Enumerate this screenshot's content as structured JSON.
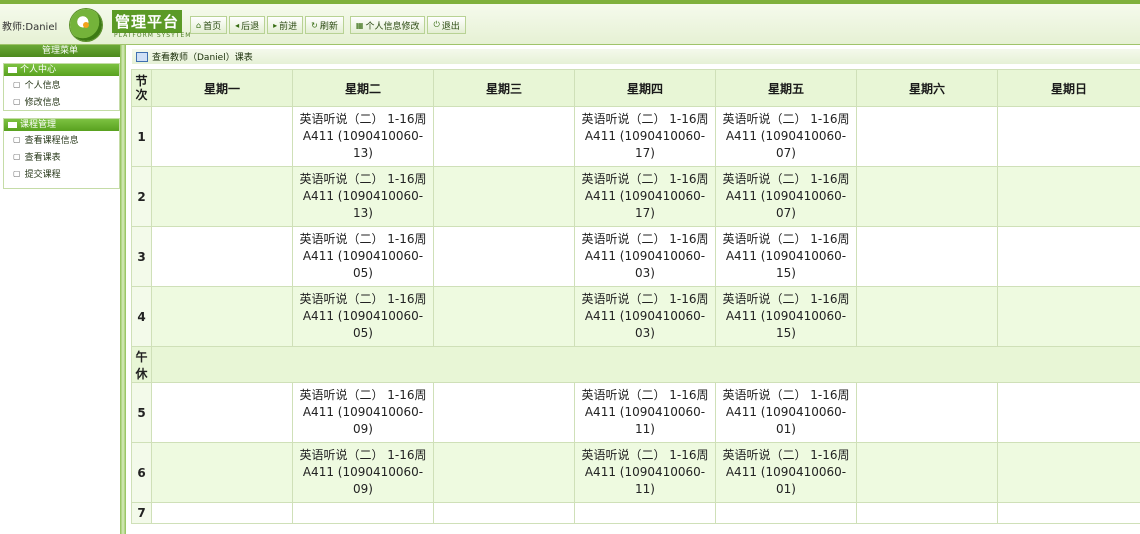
{
  "header": {
    "user_label": "教师:Daniel",
    "logo_title": "管理平台",
    "logo_subtitle": "PLATFORM SYSYTEM",
    "toolbar": [
      {
        "name": "home-button",
        "icon": "home-icon",
        "glyph": "⌂",
        "label": "首页"
      },
      {
        "name": "back-button",
        "icon": "back-icon",
        "glyph": "◂",
        "label": "后退"
      },
      {
        "name": "forward-button",
        "icon": "forward-icon",
        "glyph": "▸",
        "label": "前进"
      },
      {
        "name": "refresh-button",
        "icon": "refresh-icon",
        "glyph": "↻",
        "label": "刷新"
      },
      {
        "name": "edit-profile-button",
        "icon": "profile-icon",
        "glyph": "▦",
        "label": "个人信息修改"
      },
      {
        "name": "logout-button",
        "icon": "power-icon",
        "glyph": "⏻",
        "label": "退出"
      }
    ]
  },
  "sidebar": {
    "title": "管理菜单",
    "groups": [
      {
        "title": "个人中心",
        "items": [
          "个人信息",
          "修改信息"
        ]
      },
      {
        "title": "课程管理",
        "items": [
          "查看课程信息",
          "查看课表",
          "提交课程"
        ]
      }
    ]
  },
  "main": {
    "title": "查看教师（Daniel）课表",
    "table": {
      "period_header": "节次",
      "days": [
        "星期一",
        "星期二",
        "星期三",
        "星期四",
        "星期五",
        "星期六",
        "星期日"
      ],
      "noon_label": "午休",
      "rows": [
        {
          "period": "1",
          "cells": [
            "",
            "英语听说（二） 1-16周 A411 (1090410060-13)",
            "",
            "英语听说（二） 1-16周 A411 (1090410060-17)",
            "英语听说（二） 1-16周 A411 (1090410060-07)",
            "",
            ""
          ]
        },
        {
          "period": "2",
          "cells": [
            "",
            "英语听说（二） 1-16周 A411 (1090410060-13)",
            "",
            "英语听说（二） 1-16周 A411 (1090410060-17)",
            "英语听说（二） 1-16周 A411 (1090410060-07)",
            "",
            ""
          ]
        },
        {
          "period": "3",
          "cells": [
            "",
            "英语听说（二） 1-16周 A411 (1090410060-05)",
            "",
            "英语听说（二） 1-16周 A411 (1090410060-03)",
            "英语听说（二） 1-16周 A411 (1090410060-15)",
            "",
            ""
          ]
        },
        {
          "period": "4",
          "cells": [
            "",
            "英语听说（二） 1-16周 A411 (1090410060-05)",
            "",
            "英语听说（二） 1-16周 A411 (1090410060-03)",
            "英语听说（二） 1-16周 A411 (1090410060-15)",
            "",
            ""
          ]
        },
        {
          "period": "5",
          "cells": [
            "",
            "英语听说（二） 1-16周 A411 (1090410060-09)",
            "",
            "英语听说（二） 1-16周 A411 (1090410060-11)",
            "英语听说（二） 1-16周 A411 (1090410060-01)",
            "",
            ""
          ]
        },
        {
          "period": "6",
          "cells": [
            "",
            "英语听说（二） 1-16周 A411 (1090410060-09)",
            "",
            "英语听说（二） 1-16周 A411 (1090410060-11)",
            "英语听说（二） 1-16周 A411 (1090410060-01)",
            "",
            ""
          ]
        },
        {
          "period": "7",
          "cells": [
            "",
            "",
            "",
            "",
            "",
            "",
            ""
          ]
        }
      ]
    }
  }
}
